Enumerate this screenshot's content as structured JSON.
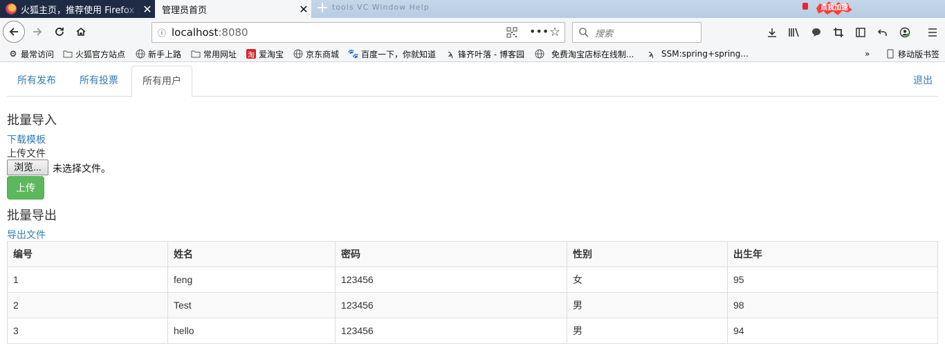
{
  "browser": {
    "tabs": [
      {
        "title": "火狐主页，推荐使用 Firefox 火狐浏览器",
        "active": false
      },
      {
        "title": "管理员首页",
        "active": true
      }
    ],
    "background_tabs_ghost": "tools  VC  Window  Help",
    "speed_badge": "点我加速",
    "url_host": "localhost",
    "url_port": ":8080",
    "search_placeholder": "搜索",
    "bookmarks": [
      {
        "label": "最常访问",
        "icon": "gear-icon"
      },
      {
        "label": "火狐官方站点",
        "icon": "folder-icon"
      },
      {
        "label": "新手上路",
        "icon": "globe-icon"
      },
      {
        "label": "常用网址",
        "icon": "folder-icon"
      },
      {
        "label": "爱淘宝",
        "icon": "taobao-icon"
      },
      {
        "label": "京东商城",
        "icon": "globe-icon"
      },
      {
        "label": "百度一下，你就知道",
        "icon": "baidu-paw-icon"
      },
      {
        "label": "锋齐叶落 - 博客园",
        "icon": "cnblogs-icon"
      },
      {
        "label": "免费淘宝店标在线制...",
        "icon": "globe-icon"
      },
      {
        "label": "SSM:spring+spring...",
        "icon": "cnblogs-icon"
      }
    ],
    "mobile_bookmarks": "移动版书签"
  },
  "nav": {
    "tabs": [
      {
        "label": "所有发布",
        "active": false
      },
      {
        "label": "所有投票",
        "active": false
      },
      {
        "label": "所有用户",
        "active": true
      }
    ],
    "logout": "退出"
  },
  "import": {
    "heading": "批量导入",
    "download_template": "下载模板",
    "upload_file_label": "上传文件",
    "browse_button": "浏览...",
    "no_file_text": "未选择文件。",
    "upload_button": "上传"
  },
  "export": {
    "heading": "批量导出",
    "export_link": "导出文件"
  },
  "table": {
    "headers": [
      "编号",
      "姓名",
      "密码",
      "性别",
      "出生年"
    ],
    "rows": [
      [
        "1",
        "feng",
        "123456",
        "女",
        "95"
      ],
      [
        "2",
        "Test",
        "123456",
        "男",
        "98"
      ],
      [
        "3",
        "hello",
        "123456",
        "男",
        "94"
      ]
    ]
  }
}
